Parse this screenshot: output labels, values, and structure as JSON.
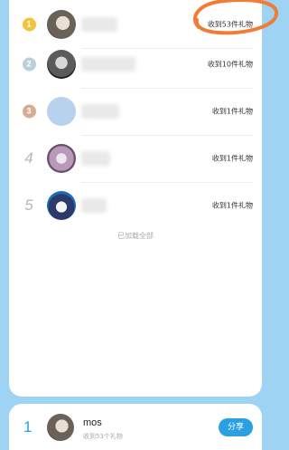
{
  "list": {
    "rows": [
      {
        "rank": "1",
        "gift": "收到53件礼物"
      },
      {
        "rank": "2",
        "gift": "收到10件礼物"
      },
      {
        "rank": "3",
        "gift": "收到1件礼物"
      },
      {
        "rank": "4",
        "gift": "收到1件礼物"
      },
      {
        "rank": "5",
        "gift": "收到1件礼物"
      }
    ],
    "loaded_text": "已加载全部"
  },
  "footer": {
    "rank": "1",
    "name": "mos",
    "subtitle": "收到53个礼物",
    "share_label": "分享"
  },
  "colors": {
    "background": "#9fd3f3",
    "accent": "#2aa0e3",
    "gold": "#f3c33b",
    "silver": "#b9cfdc",
    "bronze": "#d5ad95",
    "annotation": "#f07c35"
  },
  "icons": {
    "medal": "medal-icon",
    "annotation": "hand-drawn-circle"
  }
}
